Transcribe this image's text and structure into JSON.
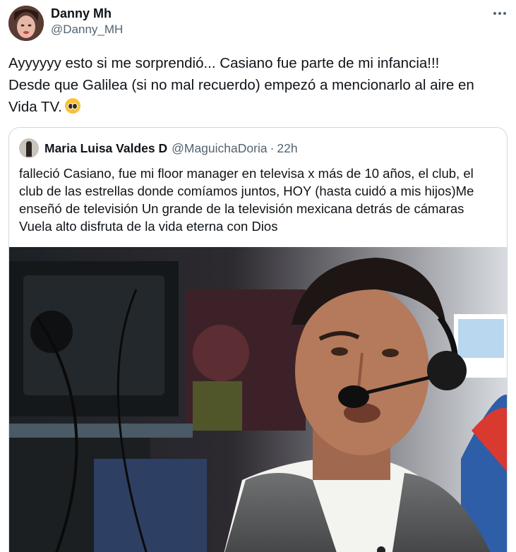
{
  "tweet": {
    "author": {
      "display_name": "Danny Mh",
      "handle": "@Danny_MH"
    },
    "more_icon": "more-horizontal-icon",
    "text_lines": [
      "Ayyyyyy esto si me sorprendió... Casiano fue parte de mi infancia!!!",
      "Desde que Galilea (si no mal recuerdo) empezó a mencionarlo al aire en",
      "Vida TV."
    ],
    "emoji": "pleading-face-emoji"
  },
  "quoted": {
    "author": {
      "display_name": "Maria Luisa Valdes D",
      "handle": "@MaguichaDoria",
      "separator": "·",
      "time": "22h"
    },
    "text_lines": [
      "falleció Casiano, fue mi floor manager en televisa x más de 10 años, el club, el",
      "club de las estrellas donde comíamos juntos, HOY (hasta cuidó a mis hijos)Me",
      "enseñó de televisión Un grande de la televisión mexicana detrás de cámaras",
      "Vuela alto disfruta de la vida eterna con Dios"
    ],
    "media": "tv-studio-photo"
  },
  "colors": {
    "text": "#0f1419",
    "secondary": "#536471",
    "border": "#cfd9de"
  }
}
